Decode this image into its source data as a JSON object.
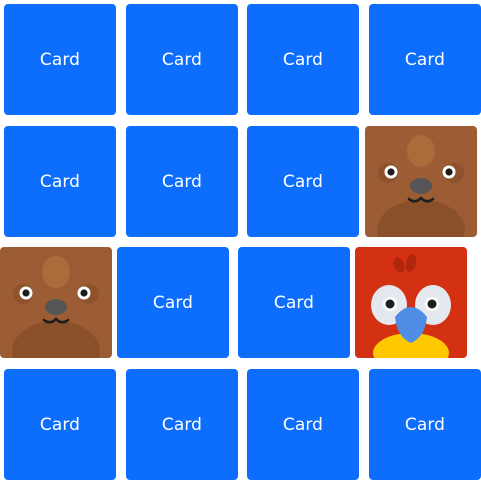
{
  "board": {
    "card_back_label": "Card",
    "colors": {
      "card_back": "#0d6efd",
      "card_back_text": "#ffffff",
      "walrus_fur": "#9c5d35",
      "parrot_red": "#d43012",
      "parrot_beak": "#4f8de6",
      "parrot_belly": "#ffc800"
    },
    "rows": [
      [
        {
          "state": "face-down",
          "label": "Card"
        },
        {
          "state": "face-down",
          "label": "Card"
        },
        {
          "state": "face-down",
          "label": "Card"
        },
        {
          "state": "face-down",
          "label": "Card"
        }
      ],
      [
        {
          "state": "face-down",
          "label": "Card"
        },
        {
          "state": "face-down",
          "label": "Card"
        },
        {
          "state": "face-down",
          "label": "Card"
        },
        {
          "state": "face-up",
          "animal": "walrus-icon"
        }
      ],
      [
        {
          "state": "face-up",
          "animal": "walrus-icon"
        },
        {
          "state": "face-down",
          "label": "Card"
        },
        {
          "state": "face-down",
          "label": "Card"
        },
        {
          "state": "face-up",
          "animal": "parrot-icon"
        }
      ],
      [
        {
          "state": "face-down",
          "label": "Card"
        },
        {
          "state": "face-down",
          "label": "Card"
        },
        {
          "state": "face-down",
          "label": "Card"
        },
        {
          "state": "face-down",
          "label": "Card"
        }
      ]
    ]
  }
}
